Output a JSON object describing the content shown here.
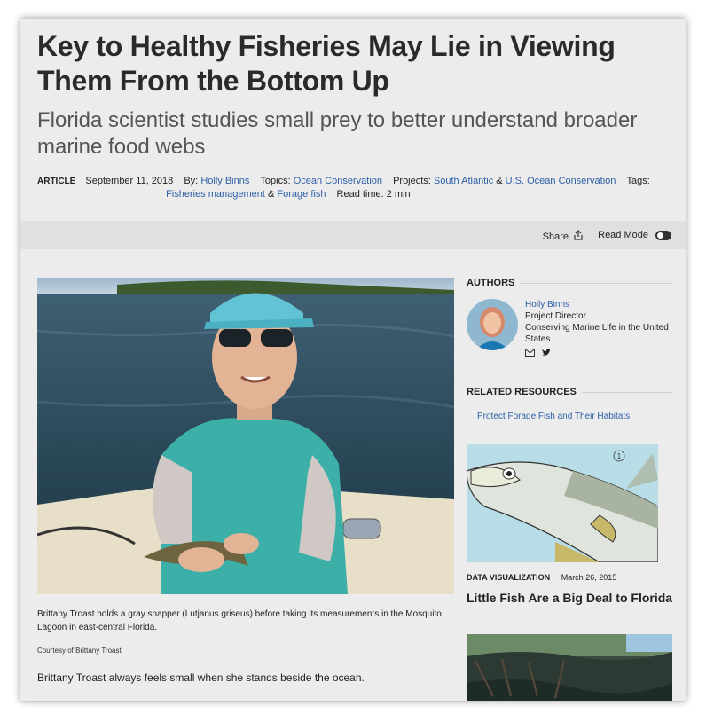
{
  "article": {
    "title": "Key to Healthy Fisheries May Lie in Viewing Them From the Bottom Up",
    "subtitle": "Florida scientist studies small prey to better understand broader marine food webs",
    "type_label": "ARTICLE",
    "date": "September 11, 2018",
    "by_label": "By:",
    "author": "Holly Binns",
    "topics_label": "Topics:",
    "topic": "Ocean Conservation",
    "projects_label": "Projects:",
    "project_1": "South Atlantic",
    "amp": "&",
    "project_2": "U.S. Ocean Conservation",
    "tags_label": "Tags:",
    "tag_1": "Fisheries management",
    "tag_2": "Forage fish",
    "read_time": "Read time: 2 min"
  },
  "toolbar": {
    "share_label": "Share",
    "read_mode_label": "Read Mode"
  },
  "hero": {
    "caption": "Brittany Troast holds a gray snapper (Lutjanus griseus) before taking its measurements in the Mosquito Lagoon in east-central Florida.",
    "credit": "Courtesy of Brittany Troast",
    "first_paragraph": "Brittany Troast always feels small when she stands beside the ocean."
  },
  "sidebar": {
    "authors_heading": "AUTHORS",
    "author_name": "Holly Binns",
    "author_role": "Project Director",
    "author_org": "Conserving Marine Life in the United States",
    "related_heading": "RELATED RESOURCES",
    "related_link": "Protect Forage Fish and Their Habitats",
    "card_kind": "DATA VISUALIZATION",
    "card_date": "March 26, 2015",
    "card_title": "Little Fish Are a Big Deal to Florida",
    "card_badge": "1"
  },
  "colors": {
    "link": "#2d5fa6",
    "page_bg": "#ececec",
    "toolbar_bg": "#e0e0e0"
  }
}
